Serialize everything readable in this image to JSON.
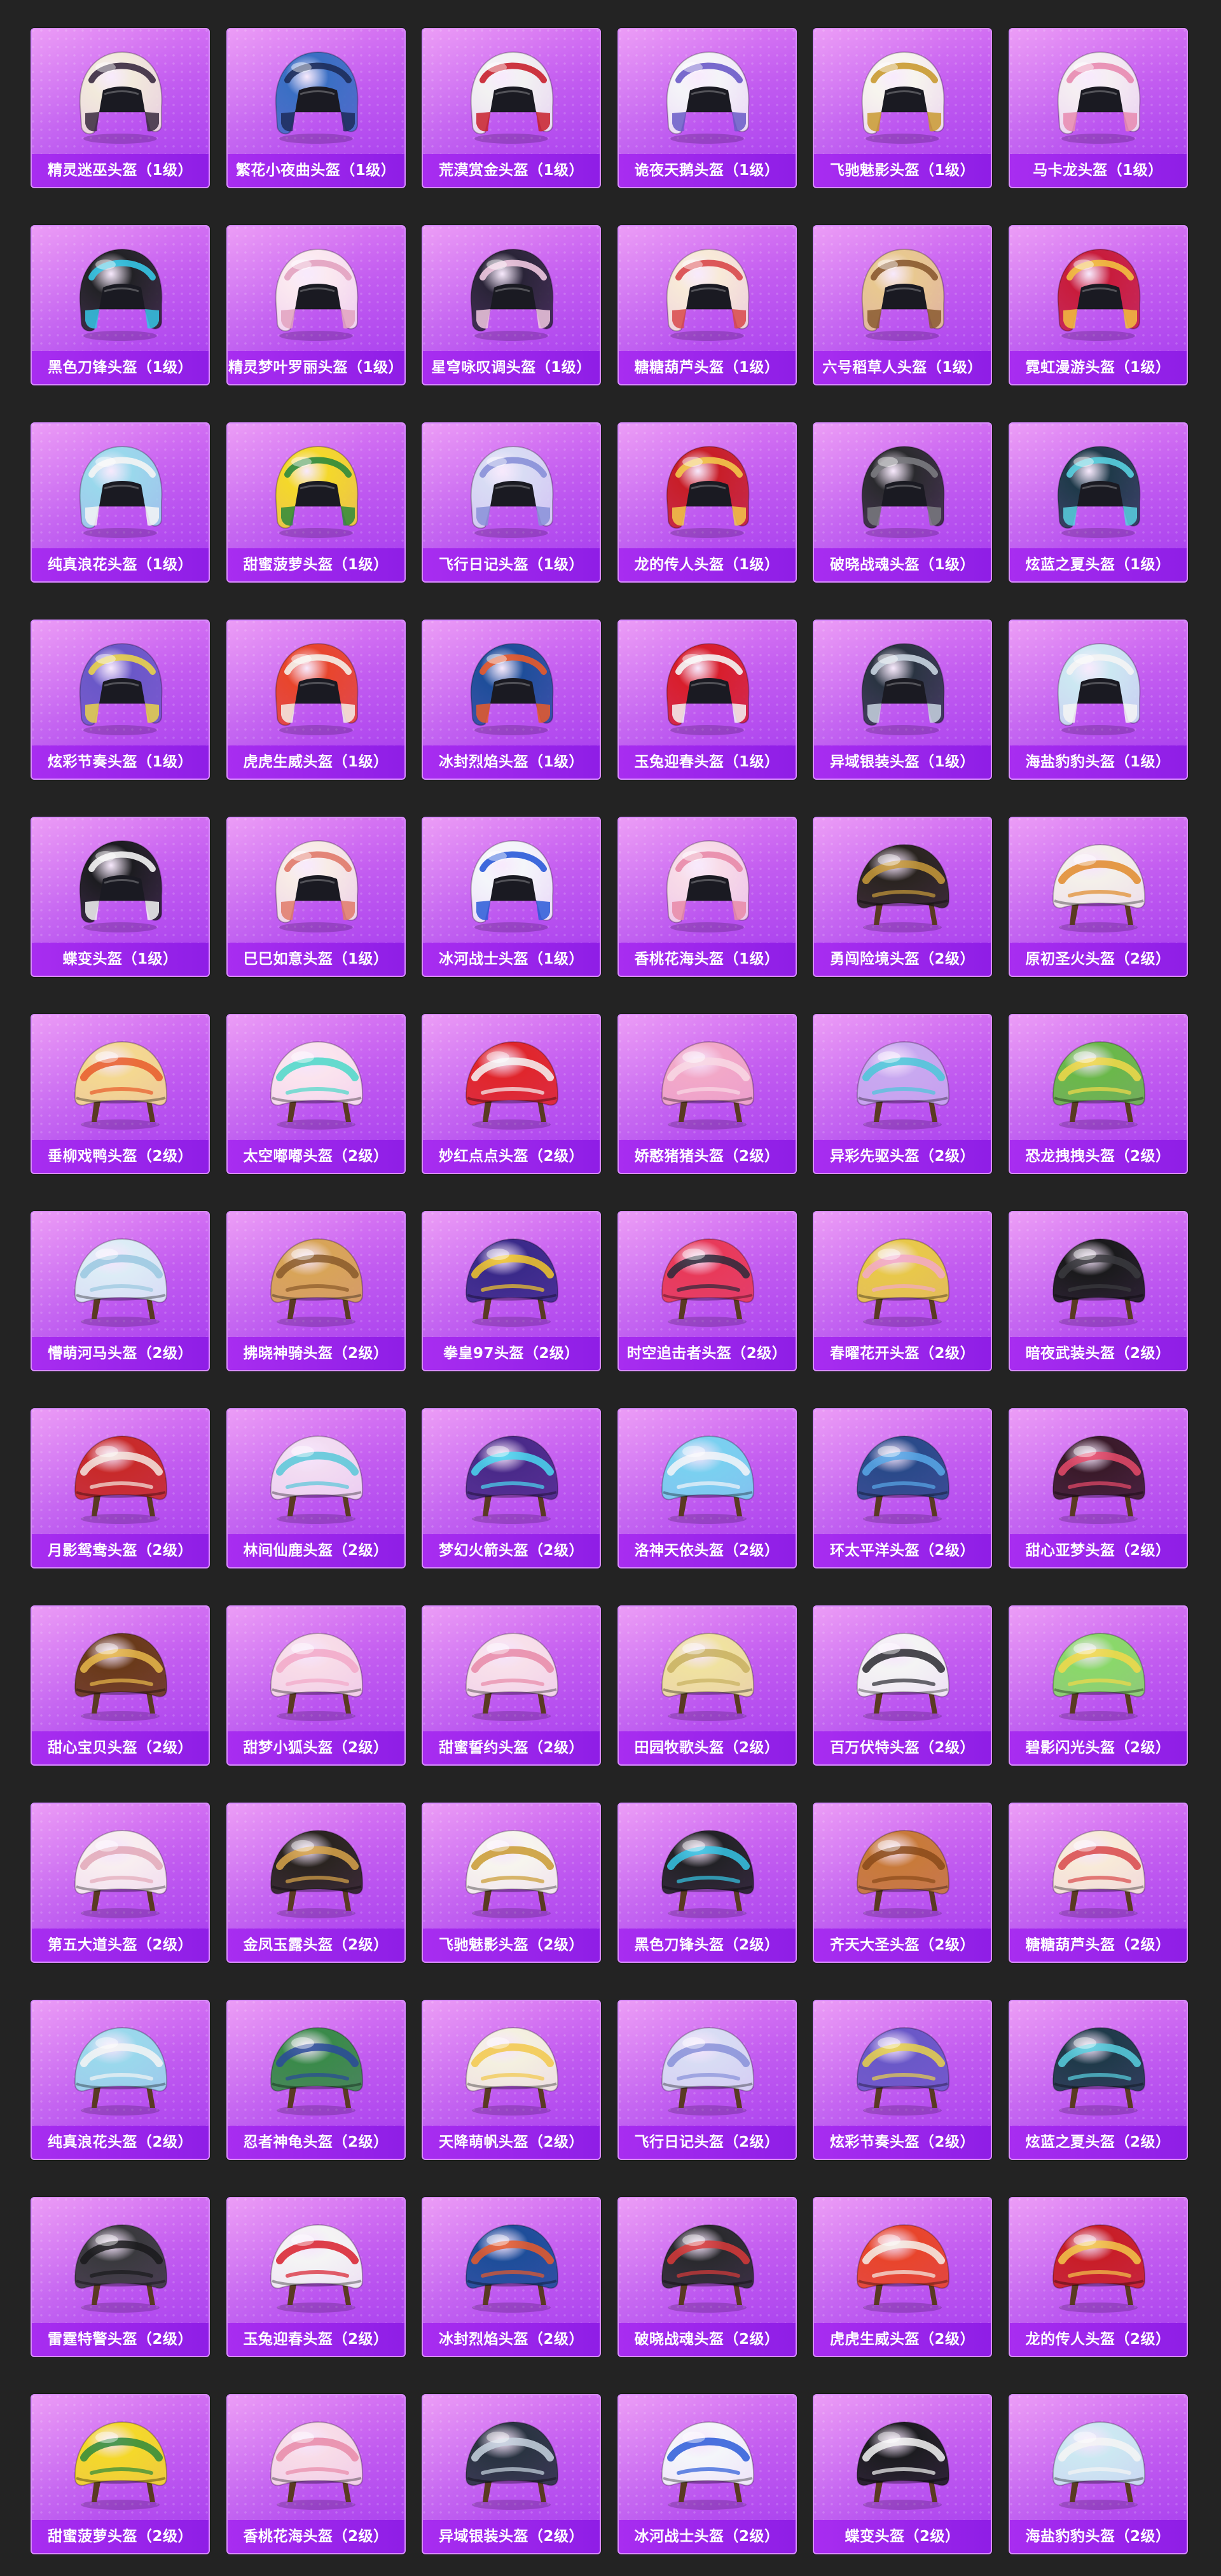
{
  "helmets": [
    {
      "name": "精灵迷巫头盔（1级）",
      "icon": "winged-fantasy-helmet",
      "colors": [
        "#f2eadc",
        "#3a2a40"
      ]
    },
    {
      "name": "繁花小夜曲头盔（1级）",
      "icon": "glitter-blue-helmet",
      "colors": [
        "#3a6fc4",
        "#1d2c5a"
      ]
    },
    {
      "name": "荒漠赏金头盔（1级）",
      "icon": "red-white-moto-helmet",
      "colors": [
        "#f2f2f2",
        "#c8202c"
      ]
    },
    {
      "name": "诡夜天鹅头盔（1级）",
      "icon": "white-moto-helmet",
      "colors": [
        "#f4f4f8",
        "#6a5ac8"
      ]
    },
    {
      "name": "飞驰魅影头盔（1级）",
      "icon": "white-gold-moto-helmet",
      "colors": [
        "#f7f5ee",
        "#c99a30"
      ]
    },
    {
      "name": "马卡龙头盔（1级）",
      "icon": "pastel-moto-helmet",
      "colors": [
        "#f5eef2",
        "#e88ab0"
      ]
    },
    {
      "name": "黑色刀锋头盔（1级）",
      "icon": "black-cyan-moto-helmet",
      "colors": [
        "#222226",
        "#36c6e6"
      ]
    },
    {
      "name": "精灵梦叶罗丽头盔（1级）",
      "icon": "pink-floral-moto-helmet",
      "colors": [
        "#fbe9f0",
        "#e2a2c0"
      ]
    },
    {
      "name": "星穹咏叹调头盔（1级）",
      "icon": "dark-winged-moto-helmet",
      "colors": [
        "#2a2438",
        "#f0c8e0"
      ]
    },
    {
      "name": "糖糖葫芦头盔（1级）",
      "icon": "candy-moto-helmet",
      "colors": [
        "#f8ead8",
        "#d8484a"
      ]
    },
    {
      "name": "六号稻草人头盔（1级）",
      "icon": "straw-moto-helmet",
      "colors": [
        "#e8c890",
        "#8a5a30"
      ]
    },
    {
      "name": "霓虹漫游头盔（1级）",
      "icon": "red-neon-moto-helmet",
      "colors": [
        "#c81c3c",
        "#f2c040"
      ]
    },
    {
      "name": "纯真浪花头盔（1级）",
      "icon": "aqua-moto-helmet",
      "colors": [
        "#9ad8ec",
        "#f4f4f4"
      ]
    },
    {
      "name": "甜蜜菠萝头盔（1级）",
      "icon": "pineapple-moto-helmet",
      "colors": [
        "#f4d82a",
        "#2e8a3c"
      ]
    },
    {
      "name": "飞行日记头盔（1级）",
      "icon": "sketch-moto-helmet",
      "colors": [
        "#d8dcf4",
        "#8890d8"
      ]
    },
    {
      "name": "龙的传人头盔（1级）",
      "icon": "red-dragon-moto-helmet",
      "colors": [
        "#c81e28",
        "#f2c84a"
      ]
    },
    {
      "name": "破晓战魂头盔（1级）",
      "icon": "spiked-black-moto-helmet",
      "colors": [
        "#2a2a2e",
        "#7a7a80"
      ]
    },
    {
      "name": "炫蓝之夏头盔（1级）",
      "icon": "teal-black-moto-helmet",
      "colors": [
        "#1f3a4a",
        "#58d0e0"
      ]
    },
    {
      "name": "炫彩节奏头盔（1级）",
      "icon": "purple-pattern-moto-helmet",
      "colors": [
        "#6a58c8",
        "#e8d24a"
      ]
    },
    {
      "name": "虎虎生威头盔（1级）",
      "icon": "tiger-moto-helmet",
      "colors": [
        "#e8452c",
        "#f4f0e8"
      ]
    },
    {
      "name": "冰封烈焰头盔（1级）",
      "icon": "ice-fire-moto-helmet",
      "colors": [
        "#1e4e9a",
        "#e85a2a"
      ]
    },
    {
      "name": "玉兔迎春头盔（1级）",
      "icon": "rabbit-red-moto-helmet",
      "colors": [
        "#d81e2c",
        "#f4f4f4"
      ]
    },
    {
      "name": "异域银装头盔（1级）",
      "icon": "silver-dark-moto-helmet",
      "colors": [
        "#2a3442",
        "#c8d4e0"
      ]
    },
    {
      "name": "海盐豹豹头盔（1级）",
      "icon": "sea-salt-moto-helmet",
      "colors": [
        "#cce8f2",
        "#f4f4f4"
      ]
    },
    {
      "name": "蝶变头盔（1级）",
      "icon": "black-butterfly-moto-helmet",
      "colors": [
        "#1c1c20",
        "#f4f4f4"
      ]
    },
    {
      "name": "巳巳如意头盔（1级）",
      "icon": "snake-moto-helmet",
      "colors": [
        "#f8ece6",
        "#e07a6a"
      ]
    },
    {
      "name": "冰河战士头盔（1级）",
      "icon": "glacier-moto-helmet",
      "colors": [
        "#f4f6fa",
        "#2a5ad8"
      ]
    },
    {
      "name": "香桃花海头盔（1级）",
      "icon": "peach-moto-helmet",
      "colors": [
        "#f8dce8",
        "#e88aa8"
      ]
    },
    {
      "name": "勇闯险境头盔（2级）",
      "icon": "viking-horn-helmet",
      "colors": [
        "#2a2420",
        "#c89a3a"
      ]
    },
    {
      "name": "原初圣火头盔（2级）",
      "icon": "flame-military-helmet",
      "colors": [
        "#f4f0ea",
        "#e08a2a"
      ]
    },
    {
      "name": "垂柳戏鸭头盔（2级）",
      "icon": "duck-military-helmet",
      "colors": [
        "#f4d890",
        "#e85a2a"
      ]
    },
    {
      "name": "太空嘟嘟头盔（2级）",
      "icon": "bunny-military-helmet",
      "colors": [
        "#fbe4ee",
        "#4ad8c8"
      ]
    },
    {
      "name": "妙红点点头盔（2级）",
      "icon": "red-dot-military-helmet",
      "colors": [
        "#e0262c",
        "#f4f4f4"
      ]
    },
    {
      "name": "娇憨猪猪头盔（2级）",
      "icon": "pig-military-helmet",
      "colors": [
        "#f2a8c8",
        "#f8d8e4"
      ]
    },
    {
      "name": "异彩先驱头盔（2级）",
      "icon": "fish-military-helmet",
      "colors": [
        "#c8a8f0",
        "#4ac8d8"
      ]
    },
    {
      "name": "恐龙拽拽头盔（2级）",
      "icon": "frog-military-helmet",
      "colors": [
        "#6ab84a",
        "#f2d84a"
      ]
    },
    {
      "name": "懵萌河马头盔（2级）",
      "icon": "hippo-military-helmet",
      "colors": [
        "#dcecf6",
        "#9ac8e0"
      ]
    },
    {
      "name": "拂晓神骑头盔（2级）",
      "icon": "gold-military-helmet",
      "colors": [
        "#d8a458",
        "#8a5a2a"
      ]
    },
    {
      "name": "拳皇97头盔（2级）",
      "icon": "kof-military-helmet",
      "colors": [
        "#3a2a8a",
        "#f2c82a"
      ]
    },
    {
      "name": "时空追击者头盔（2级）",
      "icon": "chaser-military-helmet",
      "colors": [
        "#e83a5a",
        "#2a2a3a"
      ]
    },
    {
      "name": "春曜花开头盔（2级）",
      "icon": "flower-military-helmet",
      "colors": [
        "#e8c84a",
        "#f2a8c8"
      ]
    },
    {
      "name": "暗夜武装头盔（2级）",
      "icon": "black-military-helmet",
      "colors": [
        "#1a1a1c",
        "#3a3a3e"
      ]
    },
    {
      "name": "月影鸳鸯头盔（2级）",
      "icon": "mandarin-duck-helmet",
      "colors": [
        "#c82a2a",
        "#f4e8e0"
      ]
    },
    {
      "name": "林间仙鹿头盔（2级）",
      "icon": "deer-military-helmet",
      "colors": [
        "#f2dcf2",
        "#58c8d8"
      ]
    },
    {
      "name": "梦幻火箭头盔（2级）",
      "icon": "rocket-military-helmet",
      "colors": [
        "#4a2a8a",
        "#4ad8f0"
      ]
    },
    {
      "name": "洛神天依头盔（2级）",
      "icon": "tianyi-military-helmet",
      "colors": [
        "#7ad0f0",
        "#f4f4f8"
      ]
    },
    {
      "name": "环太平洋头盔（2级）",
      "icon": "mecha-military-helmet",
      "colors": [
        "#2a4a8a",
        "#58a8e8"
      ]
    },
    {
      "name": "甜心亚梦头盔（2级）",
      "icon": "dark-heart-military-helmet",
      "colors": [
        "#3a1a2a",
        "#e84a6a"
      ]
    },
    {
      "name": "甜心宝贝头盔（2级）",
      "icon": "chick-military-helmet",
      "colors": [
        "#6a3a1a",
        "#e8b84a"
      ]
    },
    {
      "name": "甜梦小狐头盔（2级）",
      "icon": "fox-military-helmet",
      "colors": [
        "#f8dce8",
        "#f2a8c8"
      ]
    },
    {
      "name": "甜蜜誓约头盔（2级）",
      "icon": "oath-military-helmet",
      "colors": [
        "#f8e0ea",
        "#e88aa8"
      ]
    },
    {
      "name": "田园牧歌头盔（2级）",
      "icon": "straw-hat-military-helmet",
      "colors": [
        "#f0e2a0",
        "#c8b060"
      ]
    },
    {
      "name": "百万伏特头盔（2级）",
      "icon": "penguin-military-helmet",
      "colors": [
        "#f4f4f4",
        "#2a2a30"
      ]
    },
    {
      "name": "碧影闪光头盔（2级）",
      "icon": "jade-military-helmet",
      "colors": [
        "#8ad86a",
        "#f2d84a"
      ]
    },
    {
      "name": "第五大道头盔（2级）",
      "icon": "avenue-military-helmet",
      "colors": [
        "#f8eef0",
        "#e2a8b8"
      ]
    },
    {
      "name": "金凤玉露头盔（2级）",
      "icon": "phoenix-military-helmet",
      "colors": [
        "#2a2420",
        "#d8a44a"
      ]
    },
    {
      "name": "飞驰魅影头盔（2级）",
      "icon": "winged-white-military-helmet",
      "colors": [
        "#f7f5ee",
        "#c99a30"
      ]
    },
    {
      "name": "黑色刀锋头盔（2级）",
      "icon": "blade-military-helmet",
      "colors": [
        "#222226",
        "#36c6e6"
      ]
    },
    {
      "name": "齐天大圣头盔（2级）",
      "icon": "monkey-king-helmet",
      "colors": [
        "#c87a3a",
        "#8a4a1a"
      ]
    },
    {
      "name": "糖糖葫芦头盔（2级）",
      "icon": "candy-military-helmet",
      "colors": [
        "#f8ead8",
        "#d8484a"
      ]
    },
    {
      "name": "纯真浪花头盔（2级）",
      "icon": "wave-military-helmet",
      "colors": [
        "#9ad8ec",
        "#f4f4f4"
      ]
    },
    {
      "name": "忍者神龟头盔（2级）",
      "icon": "turtle-military-helmet",
      "colors": [
        "#3a8a4a",
        "#2a4a9a"
      ]
    },
    {
      "name": "天降萌帆头盔（2级）",
      "icon": "sail-military-helmet",
      "colors": [
        "#f4f0e0",
        "#f2c84a"
      ]
    },
    {
      "name": "飞行日记头盔（2级）",
      "icon": "diary-military-helmet",
      "colors": [
        "#d8dcf4",
        "#8890d8"
      ]
    },
    {
      "name": "炫彩节奏头盔（2级）",
      "icon": "rhythm-military-helmet",
      "colors": [
        "#6a58c8",
        "#e8d24a"
      ]
    },
    {
      "name": "炫蓝之夏头盔（2级）",
      "icon": "summer-military-helmet",
      "colors": [
        "#1f3a4a",
        "#58d0e0"
      ]
    },
    {
      "name": "雷霆特警头盔（2级）",
      "icon": "swat-helmet",
      "colors": [
        "#3a3a3e",
        "#1a1a1c"
      ]
    },
    {
      "name": "玉兔迎春头盔（2级）",
      "icon": "rabbit-military-helmet",
      "colors": [
        "#f4f4f4",
        "#d81e2c"
      ]
    },
    {
      "name": "冰封烈焰头盔（2级）",
      "icon": "ice-fire-military-helmet",
      "colors": [
        "#1e4e9a",
        "#e85a2a"
      ]
    },
    {
      "name": "破晓战魂头盔（2级）",
      "icon": "spiked-military-helmet",
      "colors": [
        "#2a2a2e",
        "#d83a3a"
      ]
    },
    {
      "name": "虎虎生威头盔（2级）",
      "icon": "tiger-military-helmet",
      "colors": [
        "#e8452c",
        "#f4f0e8"
      ]
    },
    {
      "name": "龙的传人头盔（2级）",
      "icon": "dragon-military-helmet",
      "colors": [
        "#c81e28",
        "#f2c84a"
      ]
    },
    {
      "name": "甜蜜菠萝头盔（2级）",
      "icon": "pineapple-military-helmet",
      "colors": [
        "#f4d82a",
        "#2e8a3c"
      ]
    },
    {
      "name": "香桃花海头盔（2级）",
      "icon": "peach-military-helmet",
      "colors": [
        "#f8dce8",
        "#e88aa8"
      ]
    },
    {
      "name": "异域银装头盔（2级）",
      "icon": "silver-military-helmet",
      "colors": [
        "#2a3442",
        "#c8d4e0"
      ]
    },
    {
      "name": "冰河战士头盔（2级）",
      "icon": "glacier-military-helmet",
      "colors": [
        "#f4f6fa",
        "#2a5ad8"
      ]
    },
    {
      "name": "蝶变头盔（2级）",
      "icon": "butterfly-military-helmet",
      "colors": [
        "#1c1c20",
        "#f4f4f4"
      ]
    },
    {
      "name": "海盐豹豹头盔（2级）",
      "icon": "sea-salt-military-helmet",
      "colors": [
        "#cce8f2",
        "#f4f4f4"
      ]
    }
  ]
}
